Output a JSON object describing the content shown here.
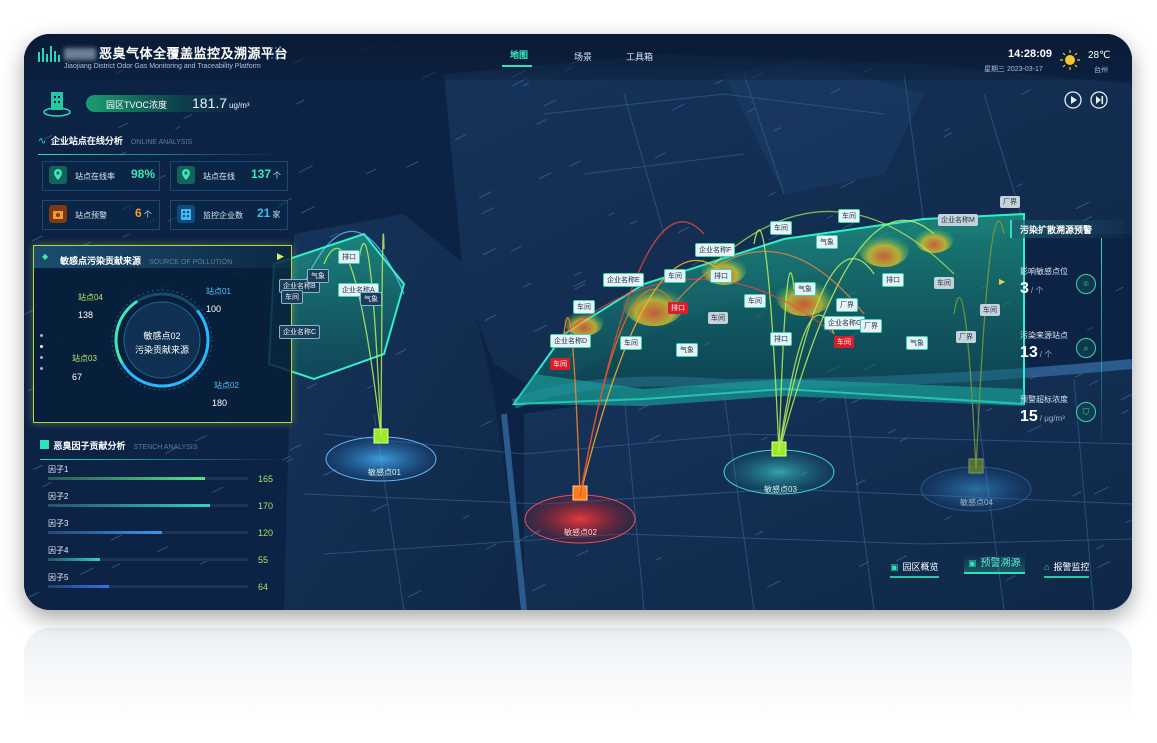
{
  "header": {
    "title_cn": "恶臭气体全覆盖监控及溯源平台",
    "title_en": "Jiaojiang District Odor Gas Monitoring and Traceability Platform",
    "tabs": [
      {
        "label": "地图",
        "active": true
      },
      {
        "label": "场景",
        "active": false
      },
      {
        "label": "工具箱",
        "active": false
      }
    ],
    "time": "14:28:09",
    "date": "星期三  2023-03-17",
    "temperature": "28℃",
    "city": "台州"
  },
  "tvoc": {
    "label": "园区TVOC浓度",
    "value": "181.7",
    "unit": "ug/m³"
  },
  "online_analysis": {
    "title": "企业站点在线分析",
    "subtitle": "ONLINE ANALYSIS",
    "metrics": [
      {
        "label": "站点在线率",
        "value": "98%",
        "unit": "",
        "color": "#3fe7b5"
      },
      {
        "label": "站点在线",
        "value": "137",
        "unit": "个",
        "color": "#3fe7b5"
      },
      {
        "label": "站点预警",
        "value": "6",
        "unit": "个",
        "color": "#f39b2a"
      },
      {
        "label": "监控企业数",
        "value": "21",
        "unit": "家",
        "color": "#3fb7f0"
      }
    ]
  },
  "pollution_source": {
    "title": "敏感点污染贡献来源",
    "subtitle": "SOURCE OF POLLUTION",
    "center_line1": "敏感点02",
    "center_line2": "污染贡献来源",
    "stations": [
      {
        "name": "站点04",
        "value": "138"
      },
      {
        "name": "站点01",
        "value": "100"
      },
      {
        "name": "站点03",
        "value": "67"
      },
      {
        "name": "站点02",
        "value": "180"
      }
    ]
  },
  "stench_analysis": {
    "title": "恶臭因子贡献分析",
    "subtitle": "STENCH ANALYSIS",
    "factors": [
      {
        "label": "因子1",
        "value": 165,
        "display": "165"
      },
      {
        "label": "因子2",
        "value": 170,
        "display": "170"
      },
      {
        "label": "因子3",
        "value": 120,
        "display": "120"
      },
      {
        "label": "因子4",
        "value": 55,
        "display": "55"
      },
      {
        "label": "因子5",
        "value": 64,
        "display": "64"
      }
    ],
    "max": 210
  },
  "right_panel": {
    "title": "污染扩散溯源预警",
    "items": [
      {
        "label": "影响敏感点位",
        "value": "3",
        "unit": "/ 个"
      },
      {
        "label": "污染来源站点",
        "value": "13",
        "unit": "/ 个"
      },
      {
        "label": "预警超标浓度",
        "value": "15",
        "unit": "/ μg/m³"
      }
    ]
  },
  "bottom_buttons": [
    {
      "label": "园区概览",
      "active": false
    },
    {
      "label": "预警溯源",
      "active": true
    },
    {
      "label": "报警监控",
      "active": false
    }
  ],
  "sensors": [
    "敏感点01",
    "敏感点02",
    "敏感点03",
    "敏感点04"
  ],
  "map_markers": {
    "enterprises": [
      "企业名称A",
      "企业名称B",
      "企业名称C",
      "企业名称D",
      "企业名称E",
      "企业名称F",
      "企业名称G",
      "企业名称M"
    ],
    "workshop": "车间",
    "weather": "气象",
    "discharge": "排口",
    "factory": "厂界"
  }
}
